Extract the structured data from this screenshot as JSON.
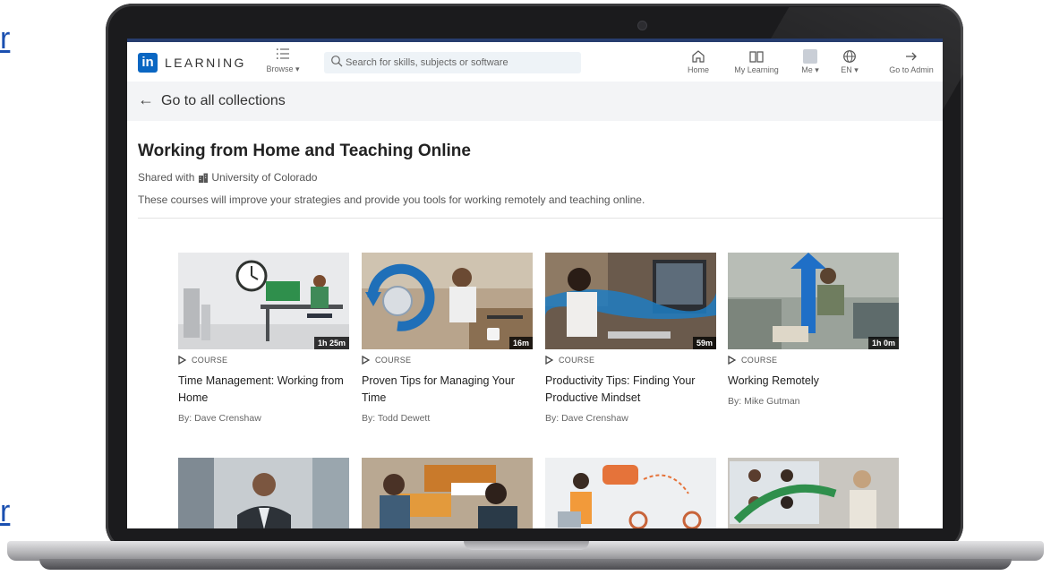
{
  "edge_links": [
    "r",
    "r"
  ],
  "nav": {
    "brand": "LEARNING",
    "browse_label": "Browse",
    "search_placeholder": "Search for skills, subjects or software",
    "items": [
      {
        "label": "Home",
        "icon": "home-icon"
      },
      {
        "label": "My Learning",
        "icon": "book-icon"
      },
      {
        "label": "Me",
        "icon": "avatar"
      },
      {
        "label": "EN",
        "icon": "globe-icon"
      },
      {
        "label": "Go to Admin",
        "icon": "arrow-right-icon"
      }
    ]
  },
  "back_link": "Go to all collections",
  "collection": {
    "title": "Working from Home and Teaching Online",
    "shared_prefix": "Shared with",
    "shared_with": "University of Colorado",
    "description": "These courses will improve your strategies and provide you tools for working remotely and teaching online."
  },
  "courses": [
    {
      "type": "COURSE",
      "title": "Time Management: Working from Home",
      "author": "By: Dave Crenshaw",
      "duration": "1h 25m"
    },
    {
      "type": "COURSE",
      "title": "Proven Tips for Managing Your Time",
      "author": "By: Todd Dewett",
      "duration": "16m"
    },
    {
      "type": "COURSE",
      "title": "Productivity Tips: Finding Your Productive Mindset",
      "author": "By: Dave Crenshaw",
      "duration": "59m"
    },
    {
      "type": "COURSE",
      "title": "Working Remotely",
      "author": "By: Mike Gutman",
      "duration": "1h 0m"
    }
  ],
  "colors": {
    "brand": "#0a66c2",
    "backbar": "#f3f4f6",
    "text": "#222222"
  }
}
